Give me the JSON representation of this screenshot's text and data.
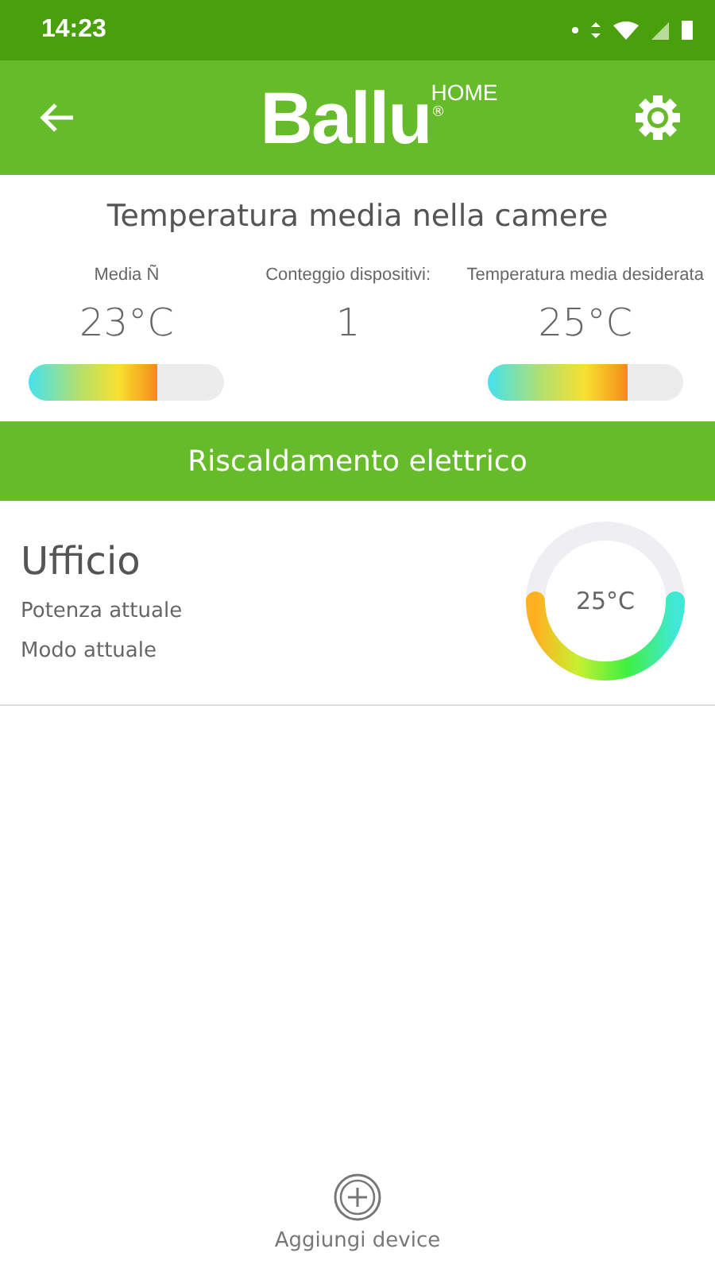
{
  "status_bar": {
    "time": "14:23"
  },
  "header": {
    "logo": "Ballu",
    "logo_sup": "HOME",
    "logo_mark": "®"
  },
  "title": "Temperatura media nella camere",
  "stats": [
    {
      "label": "Media Ñ",
      "value": "23°C",
      "level": 0.66
    },
    {
      "label": "Conteggio dispositivi:",
      "value": "1"
    },
    {
      "label": "Temperatura media desiderata",
      "value": "25°C",
      "level": 0.72
    }
  ],
  "section": "Riscaldamento elettrico",
  "devices": [
    {
      "name": "Ufficio",
      "lines": [
        "Potenza attuale",
        "Modo attuale"
      ],
      "temperature": "25°C"
    }
  ],
  "add_button": "Aggiungi device"
}
